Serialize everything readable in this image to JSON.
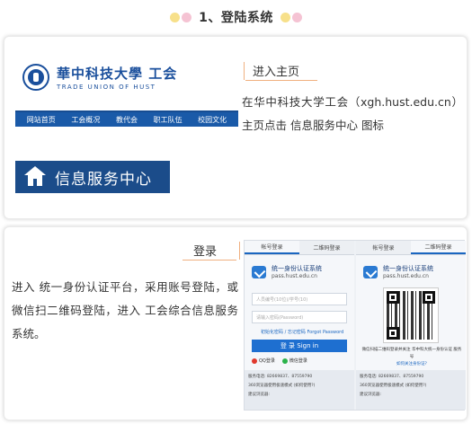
{
  "header": {
    "title": "1、登陆系统"
  },
  "step1": {
    "logo_cn": "華中科技大學 工会",
    "logo_en": "TRADE UNION OF HUST",
    "nav": [
      "网站首页",
      "工会概况",
      "教代会",
      "职工队伍",
      "校园文化"
    ],
    "banner_text": "信息服务中心",
    "title": "进入主页",
    "description": "在华中科技大学工会（xgh.hust.edu.cn）主页点击 信息服务中心 图标"
  },
  "step2": {
    "title": "登录",
    "description": "进入 统一身份认证平台，采用账号登陆，或微信扫二维码登陆，进入 工会综合信息服务系统。",
    "login": {
      "tab_account": "帐号登录",
      "tab_qr": "二维码登录",
      "brand_title": "统一身份认证系统",
      "brand_url": "pass.hust.edu.cn",
      "username_placeholder": "人员编号(10位)/学号(10)",
      "password_placeholder": "请输入密码(Password)",
      "forgot": "初始化密码 / 忘记密码 Forgot Password",
      "signin": "登 录 Sign in",
      "qq": "QQ登录",
      "wechat": "微信登录",
      "footer_phone": "服务电话: 82669837、87559790",
      "footer_email": "360浏览器使用极速模式 (如何使用?)",
      "footer_browser": "建议浏览器:",
      "qr_note": "微信扫描二维码登录并关注 华中科大统一身份认证 服务号",
      "qr_link": "如何关注身份证?"
    }
  },
  "colors": {
    "brand_blue": "#1a5aa8",
    "banner_blue": "#1b4c8a",
    "accent_orange": "#f0b080",
    "dot_yellow": "#f7e08a",
    "dot_pink": "#f5c3d3"
  }
}
